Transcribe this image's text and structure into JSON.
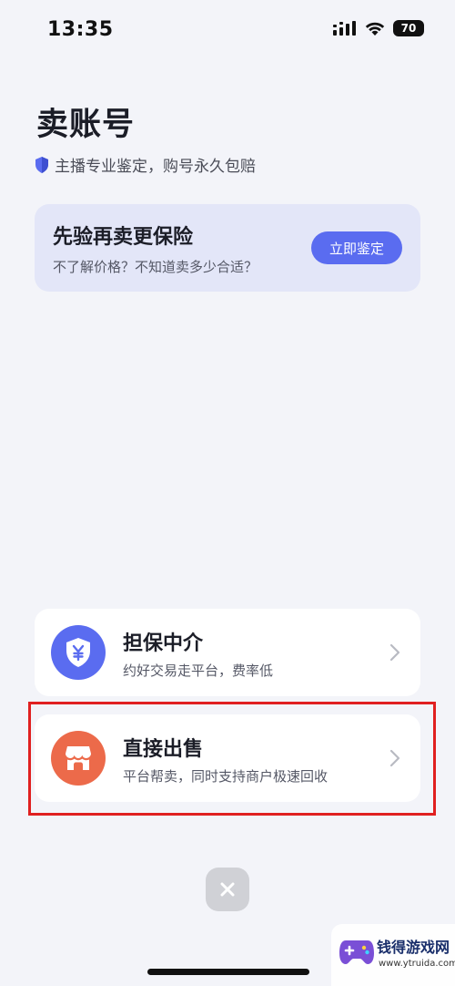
{
  "status_bar": {
    "time": "13:35",
    "battery": "70"
  },
  "header": {
    "title": "卖账号",
    "subtitle": "主播专业鉴定，购号永久包赔"
  },
  "promo": {
    "title": "先验再卖更保险",
    "subtitle": "不了解价格？不知道卖多少合适？",
    "button_label": "立即鉴定"
  },
  "options": [
    {
      "title": "担保中介",
      "subtitle": "约好交易走平台，费率低",
      "icon": "shield-yen-icon",
      "color": "#5a6cf0"
    },
    {
      "title": "直接出售",
      "subtitle": "平台帮卖，同时支持商户极速回收",
      "icon": "store-icon",
      "color": "#ec6a4a"
    }
  ],
  "watermark": {
    "name": "钱得游戏网",
    "url": "www.ytruida.com"
  },
  "colors": {
    "accent": "#5a6cf0",
    "highlight": "#e02020",
    "background": "#f3f4f9"
  }
}
